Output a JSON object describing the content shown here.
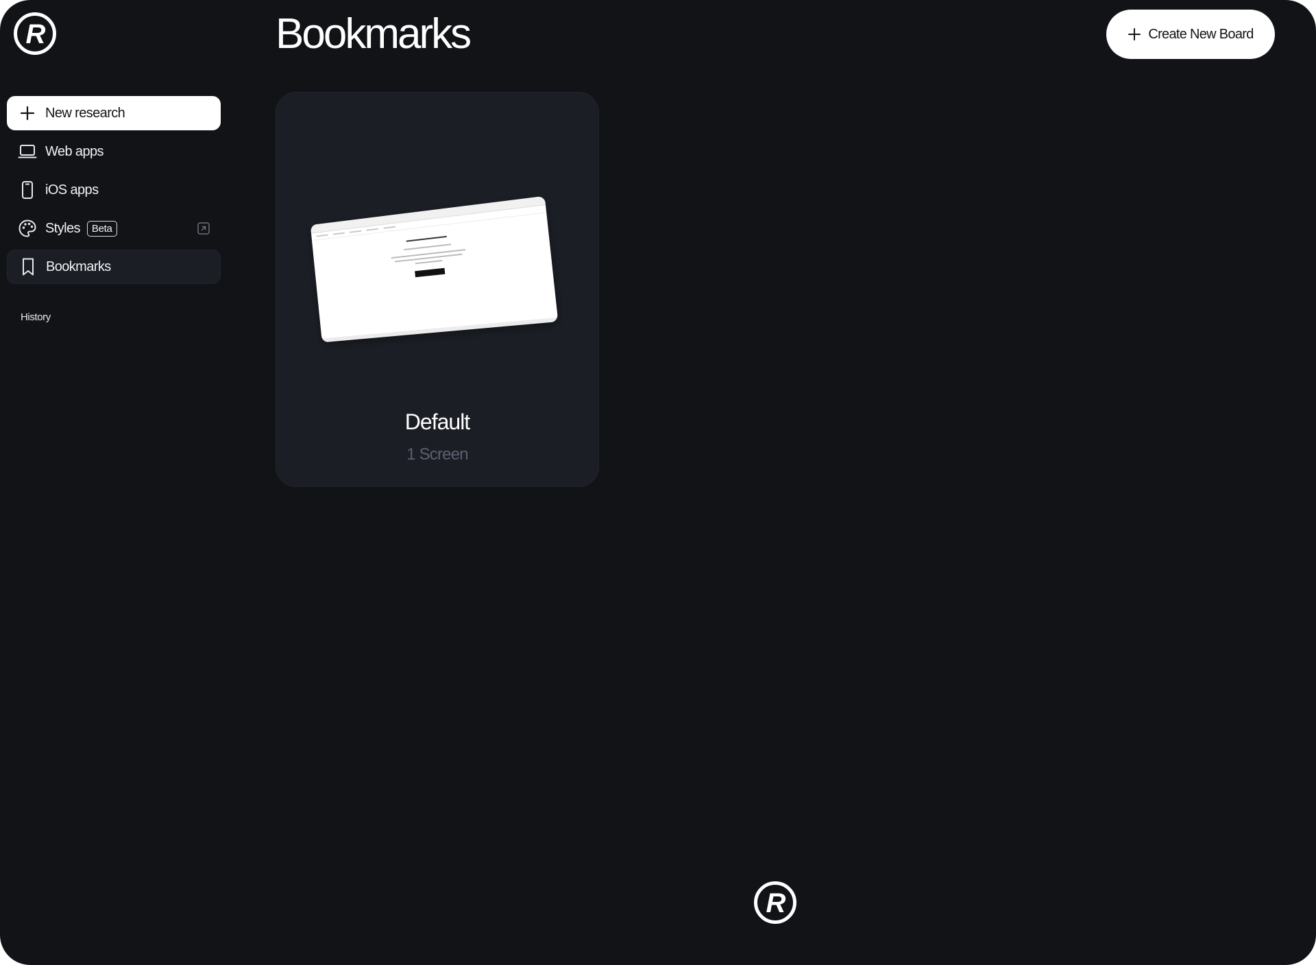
{
  "sidebar": {
    "items": [
      {
        "label": "New research",
        "icon": "plus-icon"
      },
      {
        "label": "Web apps",
        "icon": "laptop-icon"
      },
      {
        "label": "iOS apps",
        "icon": "phone-icon"
      },
      {
        "label": "Styles",
        "icon": "palette-icon",
        "badge": "Beta"
      },
      {
        "label": "Bookmarks",
        "icon": "bookmark-icon"
      }
    ],
    "history_label": "History"
  },
  "header": {
    "title": "Bookmarks",
    "create_button_label": "Create New Board"
  },
  "boards": [
    {
      "name": "Default",
      "count": "1 Screen"
    }
  ],
  "colors": {
    "background": "#111317",
    "card": "#1b1e25",
    "active_item": "#1b1e25",
    "primary_button": "#ffffff",
    "muted_text": "#5c6170"
  }
}
